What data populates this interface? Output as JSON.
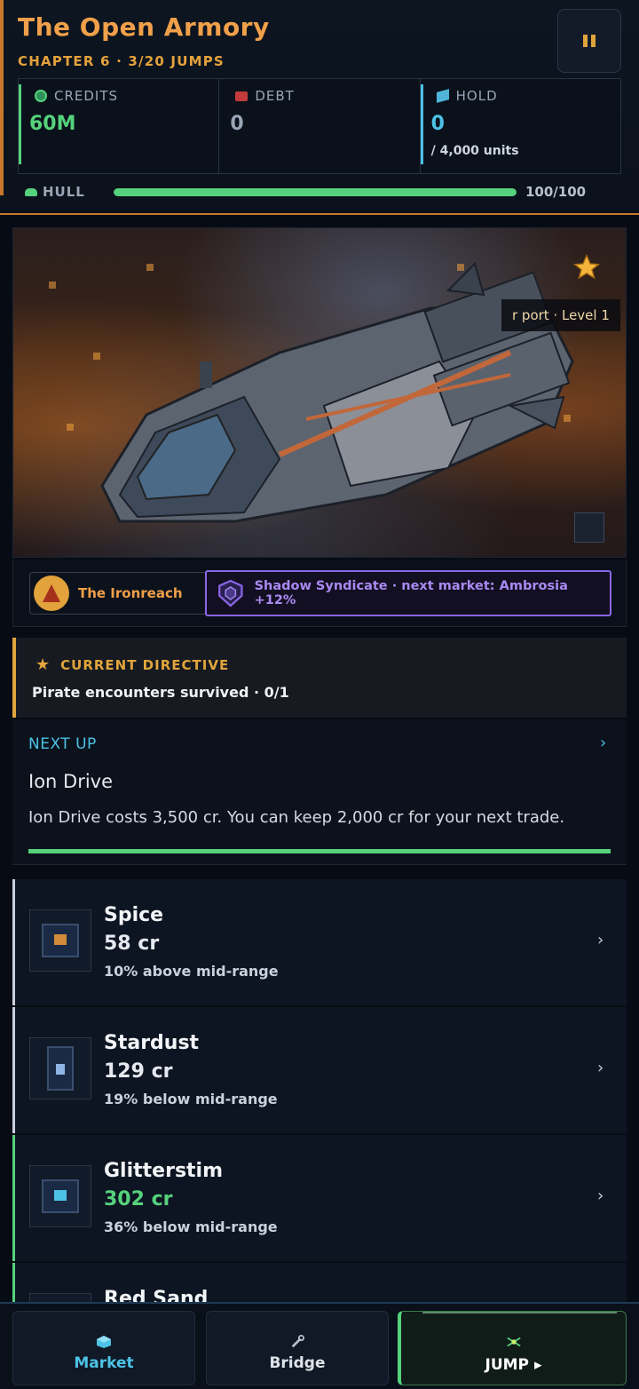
{
  "header": {
    "title": "The Open Armory",
    "subtitle": "CHAPTER 6 · 3/20 JUMPS",
    "pause_icon": "pause-icon"
  },
  "stats": {
    "credits": {
      "label": "CREDITS",
      "value": "60M",
      "color": "#56d27c",
      "icon": "coin-icon"
    },
    "debt": {
      "label": "DEBT",
      "value": "0",
      "color": "#9aa5b5",
      "icon": "debt-icon"
    },
    "hold": {
      "label": "HOLD",
      "value": "0",
      "sub": "/ 4,000 units",
      "color": "#4dc2e6",
      "icon": "cargo-icon"
    }
  },
  "hull": {
    "label": "HULL",
    "value": "100/100",
    "fraction": 1.0
  },
  "scene": {
    "port_tag": "r port · Level 1",
    "favorite_icon": "star-icon"
  },
  "factions": {
    "home": {
      "label": "The Ironreach",
      "icon": "ironreach-emblem-icon"
    },
    "rival": {
      "label": "Shadow Syndicate · next market: Ambrosia +12%",
      "icon": "shield-icon"
    }
  },
  "directive": {
    "label": "CURRENT DIRECTIVE",
    "text": "Pirate encounters survived · 0/1"
  },
  "next_up": {
    "label": "NEXT UP",
    "name": "Ion Drive",
    "description": "Ion Drive costs 3,500 cr. You can keep 2,000 cr for your next trade.",
    "progress": 1.0
  },
  "goods": [
    {
      "name": "Spice",
      "price": "58 cr",
      "note": "10% above mid-range",
      "highlight": false
    },
    {
      "name": "Stardust",
      "price": "129 cr",
      "note": "19% below mid-range",
      "highlight": false
    },
    {
      "name": "Glitterstim",
      "price": "302 cr",
      "note": "36% below mid-range",
      "highlight": true
    },
    {
      "name": "Red Sand",
      "price": "",
      "note": "",
      "highlight": true
    }
  ],
  "nav": {
    "market": "Market",
    "bridge": "Bridge",
    "jump": "JUMP ▸"
  },
  "colors": {
    "accent": "#f0a04a",
    "green": "#56d27c",
    "cyan": "#4dc2e6",
    "purple": "#8a66e8"
  }
}
